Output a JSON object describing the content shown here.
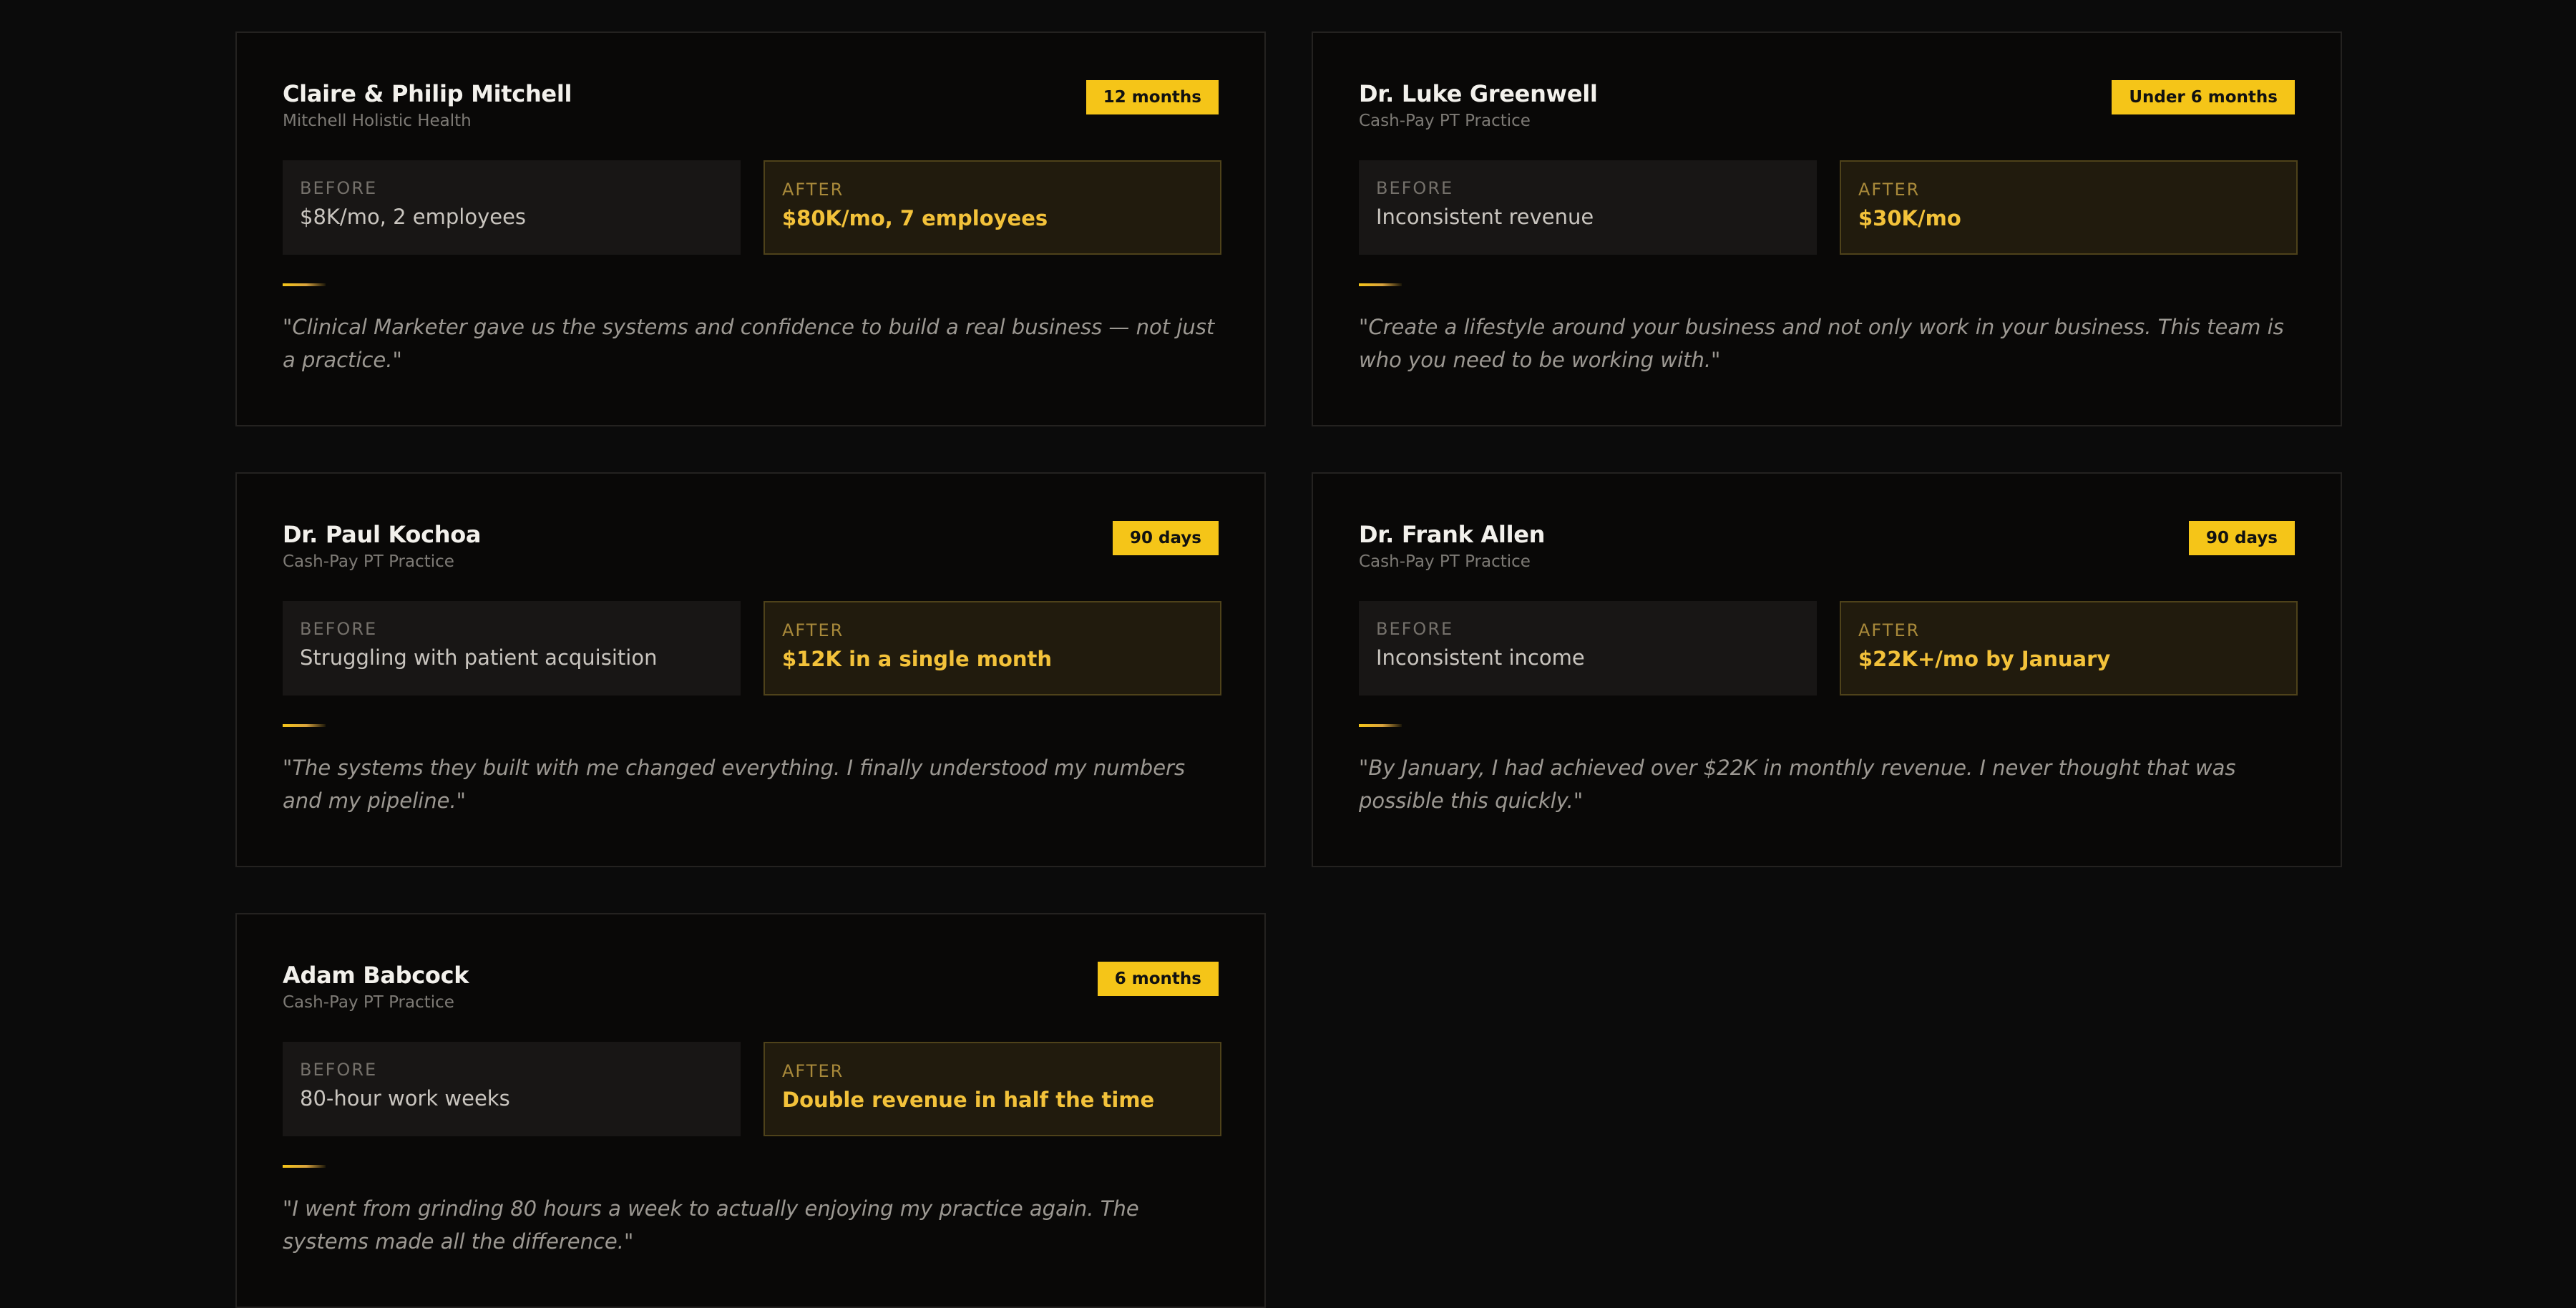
{
  "labels": {
    "before": "BEFORE",
    "after": "AFTER"
  },
  "testimonials": [
    {
      "name": "Claire & Philip Mitchell",
      "practice": "Mitchell Holistic Health",
      "badge": "12 months",
      "before": "$8K/mo, 2 employees",
      "after": "$80K/mo, 7 employees",
      "quote": "\"Clinical Marketer gave us the systems and confidence to build a real business — not just a practice.\""
    },
    {
      "name": "Dr. Luke Greenwell",
      "practice": "Cash-Pay PT Practice",
      "badge": "Under 6 months",
      "before": "Inconsistent revenue",
      "after": "$30K/mo",
      "quote": "\"Create a lifestyle around your business and not only work in your business. This team is who you need to be working with.\""
    },
    {
      "name": "Dr. Paul Kochoa",
      "practice": "Cash-Pay PT Practice",
      "badge": "90 days",
      "before": "Struggling with patient acquisition",
      "after": "$12K in a single month",
      "quote": "\"The systems they built with me changed everything. I finally understood my numbers and my pipeline.\""
    },
    {
      "name": "Dr. Frank Allen",
      "practice": "Cash-Pay PT Practice",
      "badge": "90 days",
      "before": "Inconsistent income",
      "after": "$22K+/mo by January",
      "quote": "\"By January, I had achieved over $22K in monthly revenue. I never thought that was possible this quickly.\""
    },
    {
      "name": "Adam Babcock",
      "practice": "Cash-Pay PT Practice",
      "badge": "6 months",
      "before": "80-hour work weeks",
      "after": "Double revenue in half the time",
      "quote": "\"I went from grinding 80 hours a week to actually enjoying my practice again. The systems made all the difference.\""
    }
  ],
  "colors": {
    "accent": "#f5c518",
    "background": "#0b0b0b",
    "card": "#090807",
    "after_text": "#f3c23a"
  }
}
